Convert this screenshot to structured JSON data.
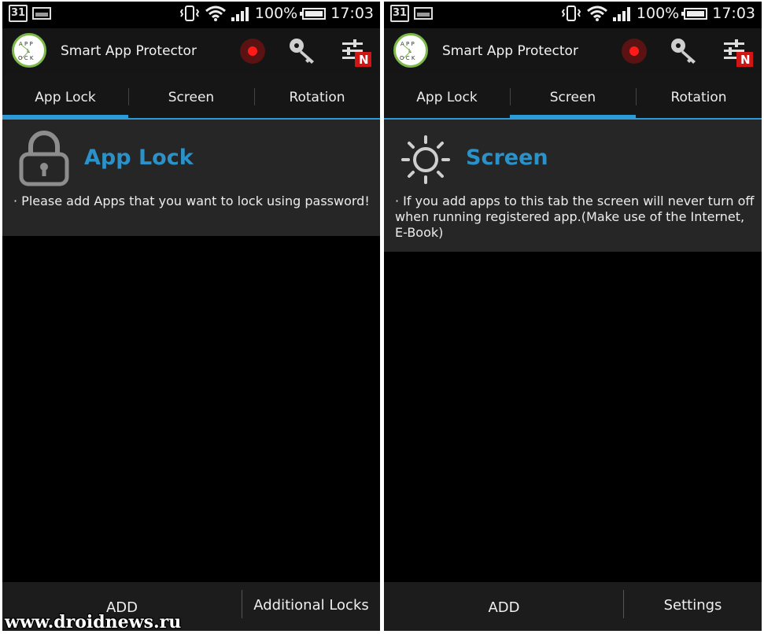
{
  "status_bar": {
    "calendar_day": "31",
    "battery": "100%",
    "time": "17:03",
    "icons": [
      "calendar-icon",
      "image-icon",
      "vibrate-icon",
      "wifi-icon",
      "signal-icon",
      "battery-icon"
    ]
  },
  "app": {
    "title": "Smart App Protector",
    "logo_text": "APP LOCK",
    "accent_color": "#2b9ad6",
    "record_color": "#ff1a1a"
  },
  "tabs": [
    "App Lock",
    "Screen",
    "Rotation"
  ],
  "screens": [
    {
      "active_tab": 0,
      "panel_title": "App Lock",
      "panel_icon": "padlock-icon",
      "panel_desc": "· Please add Apps that you want to lock using password!",
      "bottom_left": "ADD",
      "bottom_right": "Additional Locks"
    },
    {
      "active_tab": 1,
      "panel_title": "Screen",
      "panel_icon": "sun-icon",
      "panel_desc": "· If you add apps to this tab the screen will never turn off when running registered app.(Make use of the Internet, E-Book)",
      "bottom_left": "ADD",
      "bottom_right": "Settings"
    }
  ],
  "watermark": "www.droidnews.ru"
}
